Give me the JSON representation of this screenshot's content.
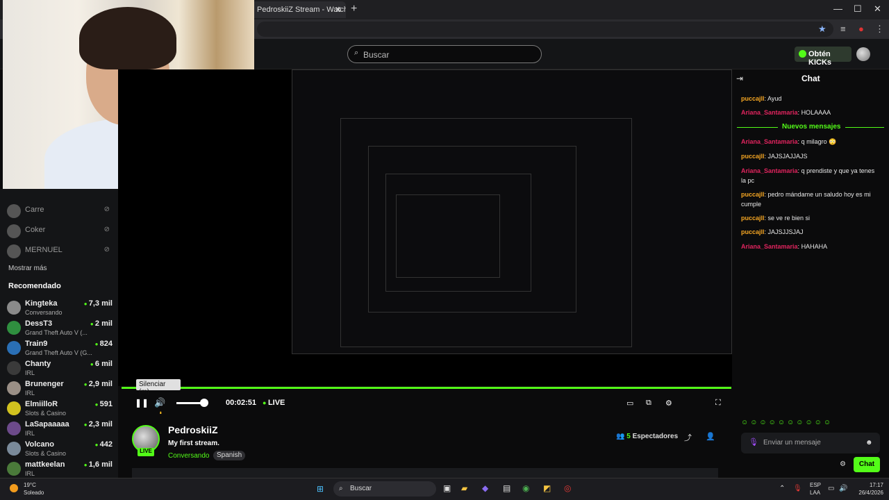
{
  "browser": {
    "tab_title": "PedroskiiZ Stream - Watch",
    "tab_close": "✕",
    "new_tab": "+",
    "win_min": "—",
    "win_max": "☐",
    "win_close": "✕"
  },
  "header": {
    "search_placeholder": "Buscar",
    "kicks_label": "Obtén KICKs"
  },
  "sidebar": {
    "offline": [
      {
        "name": "Carre"
      },
      {
        "name": "Coker"
      },
      {
        "name": "MERNUEL"
      }
    ],
    "show_more": "Mostrar más",
    "recommended_title": "Recomendado",
    "recommended": [
      {
        "name": "Kingteka",
        "sub": "Conversando",
        "count": "7,3 mil",
        "color": "#8a8a8a"
      },
      {
        "name": "DessT3",
        "sub": "Grand Theft Auto V (...",
        "count": "2 mil",
        "color": "#2f8f3f"
      },
      {
        "name": "Train9",
        "sub": "Grand Theft Auto V (G...",
        "count": "824",
        "color": "#2a6fb5"
      },
      {
        "name": "Chanty",
        "sub": "IRL",
        "count": "6 mil",
        "color": "#3a3a3a"
      },
      {
        "name": "Brunenger",
        "sub": "IRL",
        "count": "2,9 mil",
        "color": "#9a8f86"
      },
      {
        "name": "ElmiilloR",
        "sub": "Slots & Casino",
        "count": "591",
        "color": "#d1c21f"
      },
      {
        "name": "LaSapaaaaa",
        "sub": "IRL",
        "count": "2,3 mil",
        "color": "#6c4a8a"
      },
      {
        "name": "Volcano",
        "sub": "Slots & Casino",
        "count": "442",
        "color": "#7a8a9a"
      },
      {
        "name": "mattkeelan",
        "sub": "IRL",
        "count": "1,6 mil",
        "color": "#4a7a3a"
      }
    ]
  },
  "player": {
    "mute_tooltip": "Silenciar (m)",
    "time": "00:02:51",
    "live_label": "LIVE"
  },
  "stream_info": {
    "streamer": "PedroskiiZ",
    "live_badge": "LIVE",
    "title": "My first stream.",
    "category": "Conversando",
    "language": "Spanish",
    "viewer_count": "5",
    "viewer_label": "Espectadores"
  },
  "chat": {
    "title": "Chat",
    "new_messages": "Nuevos mensajes",
    "messages_before": [
      {
        "user": "puccajll",
        "text": "Ayud",
        "color": "#f5a623"
      },
      {
        "user": "Ariana_Santamaria",
        "text": "HOLAAAA",
        "color": "#e0245e"
      }
    ],
    "messages_after": [
      {
        "user": "Ariana_Santamaria",
        "text": "q milagro 😳",
        "color": "#e0245e"
      },
      {
        "user": "puccajll",
        "text": "JAJSJAJJAJS",
        "color": "#f5a623"
      },
      {
        "user": "Ariana_Santamaria",
        "text": "q prendiste y que ya tenes la pc",
        "color": "#e0245e"
      },
      {
        "user": "puccajll",
        "text": "pedro mándame un saludo hoy es mi cumple",
        "color": "#f5a623"
      },
      {
        "user": "puccajll",
        "text": "se ve re bien si",
        "color": "#f5a623"
      },
      {
        "user": "puccajll",
        "text": "JAJSJJSJAJ",
        "color": "#f5a623"
      },
      {
        "user": "Ariana_Santamaria",
        "text": "HAHAHA",
        "color": "#e0245e"
      }
    ],
    "input_placeholder": "Enviar un mensaje",
    "send_label": "Chat"
  },
  "taskbar": {
    "weather_temp": "19°C",
    "weather_cond": "Soleado",
    "search_label": "Buscar",
    "lang1": "ESP",
    "lang2": "LAA",
    "time": "17:17",
    "date": "26/4/2026"
  },
  "colors": {
    "accent": "#53fc18",
    "background": "#0b0b0c"
  }
}
